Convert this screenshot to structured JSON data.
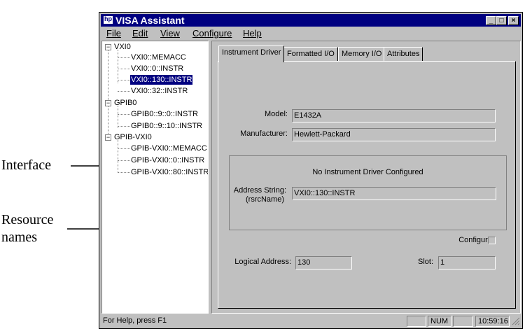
{
  "annotations": {
    "interface": "Interface",
    "resource_names_1": "Resource",
    "resource_names_2": "names"
  },
  "window": {
    "title": "VISA Assistant",
    "minimize": "_",
    "maximize": "□",
    "close": "×"
  },
  "menu": [
    "File",
    "Edit",
    "View",
    "Configure",
    "Help"
  ],
  "tree": {
    "groups": [
      {
        "label": "VXI0",
        "children": [
          "VXI0::MEMACC",
          "VXI0::0::INSTR",
          "VXI0::130::INSTR",
          "VXI0::32::INSTR"
        ]
      },
      {
        "label": "GPIB0",
        "children": [
          "GPIB0::9::0::INSTR",
          "GPIB0::9::10::INSTR"
        ]
      },
      {
        "label": "GPIB-VXI0",
        "children": [
          "GPIB-VXI0::MEMACC",
          "GPIB-VXI0::0::INSTR",
          "GPIB-VXI0::80::INSTR"
        ]
      }
    ],
    "expand_symbol": "−",
    "selected": "VXI0::130::INSTR"
  },
  "tabs": [
    "Instrument Driver",
    "Formatted I/O",
    "Memory I/O",
    "Attributes"
  ],
  "driver": {
    "model_label": "Model:",
    "model_value": "E1432A",
    "manufacturer_label": "Manufacturer:",
    "manufacturer_value": "Hewlett-Packard",
    "group_message": "No Instrument Driver Configured",
    "address_label_1": "Address String:",
    "address_label_2": "(rsrcName)",
    "address_value": "VXI0::130::INSTR",
    "configure_label": "Configure:",
    "logical_address_label": "Logical Address:",
    "logical_address_value": "130",
    "slot_label": "Slot:",
    "slot_value": "1"
  },
  "status": {
    "help": "For Help, press F1",
    "num": "NUM",
    "time": "10:59:16"
  }
}
